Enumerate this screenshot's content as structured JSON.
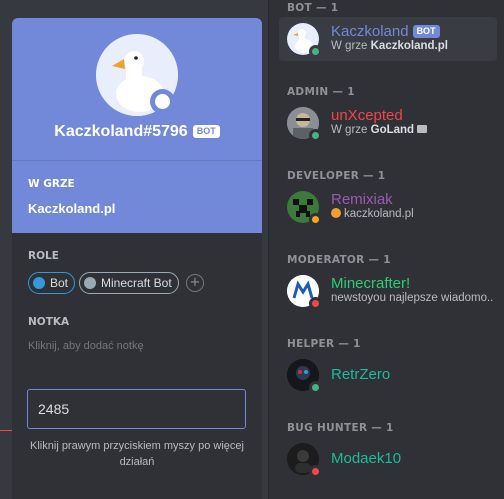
{
  "popout": {
    "username": "Kaczkoland#5796",
    "bot_tag": "BOT",
    "activity_label": "W GRZE",
    "activity_value": "Kaczkoland.pl",
    "roles_label": "ROLE",
    "roles": [
      {
        "name": "Bot",
        "color": "#3498db"
      },
      {
        "name": "Minecraft Bot",
        "color": "#99aab5"
      }
    ],
    "add_role": "+",
    "note_label": "NOTKA",
    "note_placeholder": "Kliknij, aby dodać notkę",
    "message_value": "2485",
    "hint": "Kliknij prawym przyciskiem myszy po więcej działań"
  },
  "member_list": {
    "groups": [
      {
        "header": "BOT — 1",
        "members": [
          {
            "name": "Kaczkoland",
            "bot_tag": "BOT",
            "sub_prefix": "W grze ",
            "sub_bold": "Kaczkoland.pl",
            "name_color": "#7289da",
            "status": "online"
          }
        ]
      },
      {
        "header": "ADMIN — 1",
        "members": [
          {
            "name": "unXcepted",
            "sub_prefix": "W grze ",
            "sub_bold": "GoLand",
            "name_color": "#f04747",
            "status": "online",
            "sub_icon": "game-icon"
          }
        ]
      },
      {
        "header": "DEVELOPER — 1",
        "members": [
          {
            "name": "Remixiak",
            "sub_text": "kaczkoland.pl",
            "name_color": "#9b59b6",
            "status": "idle",
            "sub_icon": "planet-emoji-icon"
          }
        ]
      },
      {
        "header": "MODERATOR — 1",
        "members": [
          {
            "name": "Minecrafter!",
            "sub_text": "newstoyou najlepsze wiadomo...",
            "name_color": "#2ecc71",
            "status": "dnd"
          }
        ]
      },
      {
        "header": "HELPER — 1",
        "members": [
          {
            "name": "RetrZero",
            "name_color": "#1abc9c",
            "status": "online"
          }
        ]
      },
      {
        "header": "BUG HUNTER — 1",
        "members": [
          {
            "name": "Modaek10",
            "name_color": "#1abc9c",
            "status": "dnd"
          }
        ]
      }
    ]
  }
}
